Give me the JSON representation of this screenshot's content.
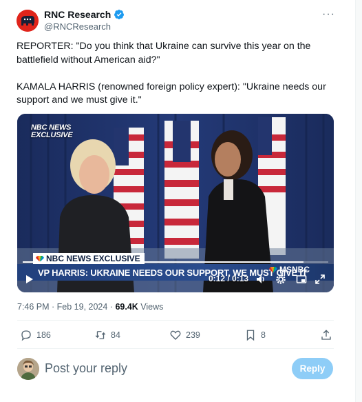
{
  "author": {
    "name": "RNC Research",
    "handle": "@RNCResearch"
  },
  "more_label": "···",
  "tweet": {
    "line1": "REPORTER: \"Do you think that Ukraine can survive this year on the",
    "line2": "battlefield without American aid?\"",
    "line3": "KAMALA HARRIS (renowned foreign policy expert): \"Ukraine needs our",
    "line4": "support and we must give it.\""
  },
  "video": {
    "corner_tag_line1": "NBC NEWS",
    "corner_tag_line2": "EXCLUSIVE",
    "lower_third_tag": "NBC NEWS EXCLUSIVE",
    "headline": "VP HARRIS: UKRAINE NEEDS OUR SUPPORT, WE MUST GIVE IT",
    "network": "MSNBC",
    "time": "0:12 / 0:13",
    "progress": 0.92
  },
  "meta": {
    "timestamp": "7:46 PM · Feb 19, 2024 · ",
    "views_count": "69.4K",
    "views_label": " Views"
  },
  "actions": {
    "replies": "186",
    "reposts": "84",
    "likes": "239",
    "bookmarks": "8"
  },
  "reply": {
    "placeholder": "Post your reply",
    "button_label": "Reply"
  },
  "colors": {
    "accent": "#1d9bf0",
    "reply_button": "#8ecdf7",
    "brand_red": "#e0241b"
  }
}
